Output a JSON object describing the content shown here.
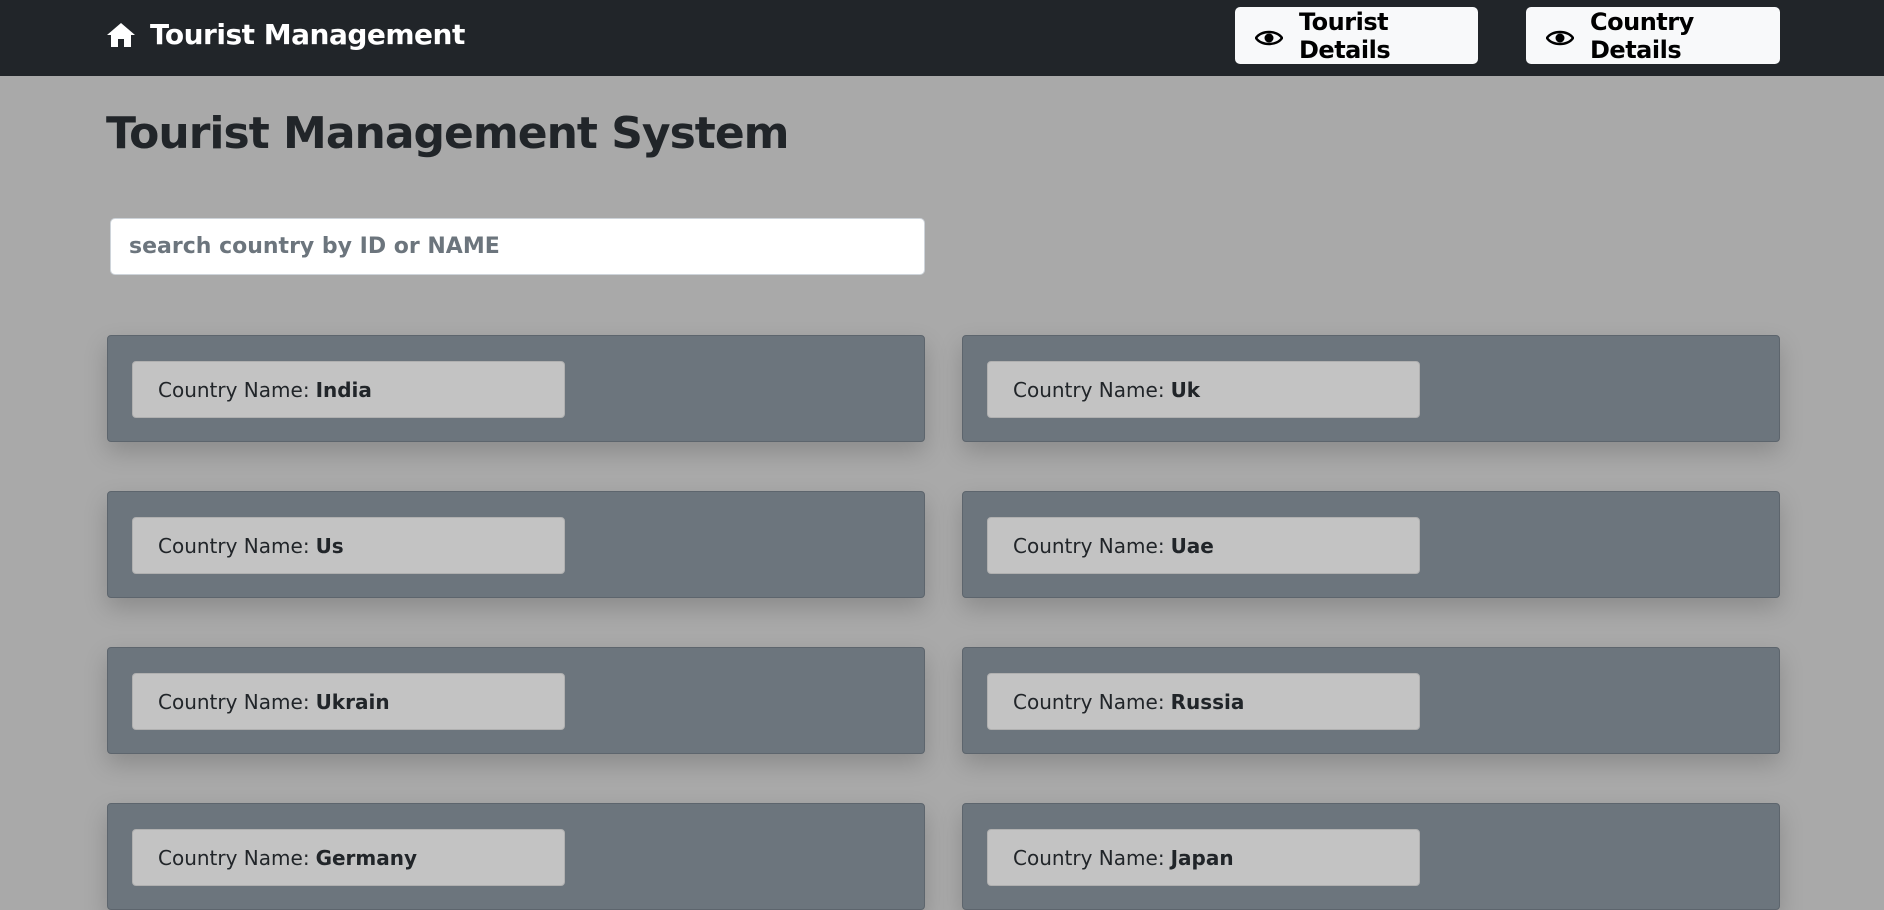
{
  "navbar": {
    "brand": "Tourist Management",
    "buttons": [
      {
        "label": "Tourist Details"
      },
      {
        "label": "Country Details"
      }
    ]
  },
  "page": {
    "title": "Tourist Management System"
  },
  "search": {
    "placeholder": "search country by ID or NAME"
  },
  "countries": [
    {
      "label": "Country Name:",
      "name": "India"
    },
    {
      "label": "Country Name:",
      "name": "Uk"
    },
    {
      "label": "Country Name:",
      "name": "Us"
    },
    {
      "label": "Country Name:",
      "name": "Uae"
    },
    {
      "label": "Country Name:",
      "name": "Ukrain"
    },
    {
      "label": "Country Name:",
      "name": "Russia"
    },
    {
      "label": "Country Name:",
      "name": "Germany"
    },
    {
      "label": "Country Name:",
      "name": "Japan"
    }
  ],
  "icons": {
    "brand": "home-icon",
    "nav_button": "eye-icon"
  },
  "colors": {
    "navbar_bg": "#212529",
    "page_bg": "#a9a9a9",
    "card_bg": "#6c757d",
    "pill_bg": "#c3c3c3"
  }
}
